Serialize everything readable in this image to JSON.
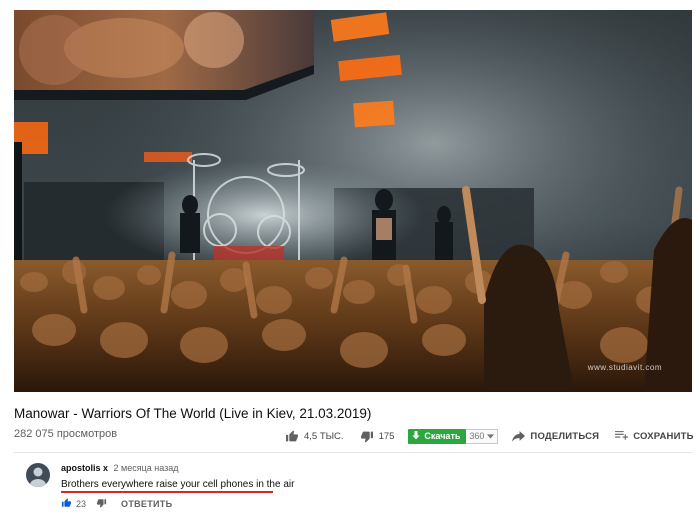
{
  "video": {
    "watermark": "www.studiavit.com",
    "title": "Manowar - Warriors Of The World (Live in Kiev, 21.03.2019)",
    "views": "282 075 просмотров",
    "likes": "4,5 ТЫС.",
    "dislikes": "175",
    "download_label": "Скачать",
    "download_quality": "360",
    "share_label": "ПОДЕЛИТЬСЯ",
    "save_label": "СОХРАНИТЬ",
    "more_label": "···"
  },
  "comment": {
    "author": "apostolis x",
    "time": "2 месяца назад",
    "text": "Brothers everywhere raise your cell phones in the air",
    "likes": "23",
    "reply_label": "ОТВЕТИТЬ",
    "highlight_color": "#d8262a"
  },
  "colors": {
    "download_green": "#2ba640",
    "like_blue": "#065fd4"
  }
}
